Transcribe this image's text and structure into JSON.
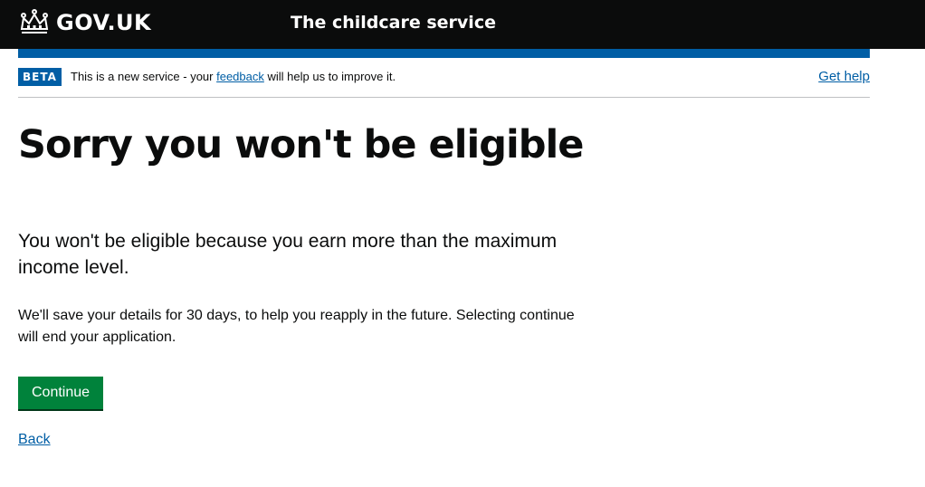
{
  "header": {
    "logo_text": "GOV.UK",
    "logo_icon": "crown-icon",
    "service_name": "The childcare service"
  },
  "phase_banner": {
    "tag": "BETA",
    "text_before": "This is a new service - your ",
    "feedback_link": "feedback",
    "text_after": " will help us to improve it.",
    "help_link": "Get help"
  },
  "main": {
    "heading": "Sorry you won't be eligible",
    "lede": "You won't be eligible because you earn more than the maximum income level.",
    "body": "We'll save your details for 30 days, to help you reapply in the future. Selecting continue will end your application.",
    "continue_label": "Continue",
    "back_label": "Back"
  },
  "colors": {
    "header_bg": "#0b0c0c",
    "brand_blue": "#005ea5",
    "button_green": "#00823b",
    "text": "#0b0c0c"
  }
}
